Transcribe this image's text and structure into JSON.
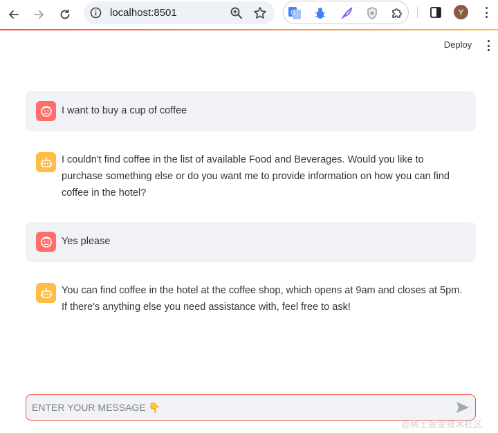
{
  "browser": {
    "url": "localhost:8501",
    "profile_initial": "Y",
    "icons": {
      "back": "back-arrow-icon",
      "forward": "forward-arrow-icon",
      "reload": "reload-icon",
      "site_info": "site-info-icon",
      "zoom": "zoom-icon",
      "bookmark": "bookmark-star-icon",
      "extensions": [
        "translate-extension-icon",
        "bug-extension-icon",
        "feather-extension-icon",
        "shield-extension-icon",
        "puzzle-extensions-icon"
      ],
      "side_panel": "side-panel-icon",
      "menu": "kebab-menu-icon"
    },
    "accent_colors": [
      "#ff4b4b",
      "#ffbd45"
    ]
  },
  "app": {
    "deploy_label": "Deploy"
  },
  "chat": {
    "messages": [
      {
        "role": "user",
        "text": "I want to buy a cup of coffee"
      },
      {
        "role": "assistant",
        "text": "I couldn't find coffee in the list of available Food and Beverages. Would you like to purchase something else or do you want me to provide information on how you can find coffee in the hotel?"
      },
      {
        "role": "user",
        "text": "Yes please"
      },
      {
        "role": "assistant",
        "text": "You can find coffee in the hotel at the coffee shop, which opens at 9am and closes at 5pm. If there's anything else you need assistance with, feel free to ask!"
      }
    ],
    "user_avatar_color": "#ff6c6c",
    "assistant_avatar_color": "#ffbd45",
    "input": {
      "placeholder": "ENTER YOUR MESSAGE 👇",
      "value": ""
    }
  },
  "watermark": "@稀土掘金技术社区"
}
